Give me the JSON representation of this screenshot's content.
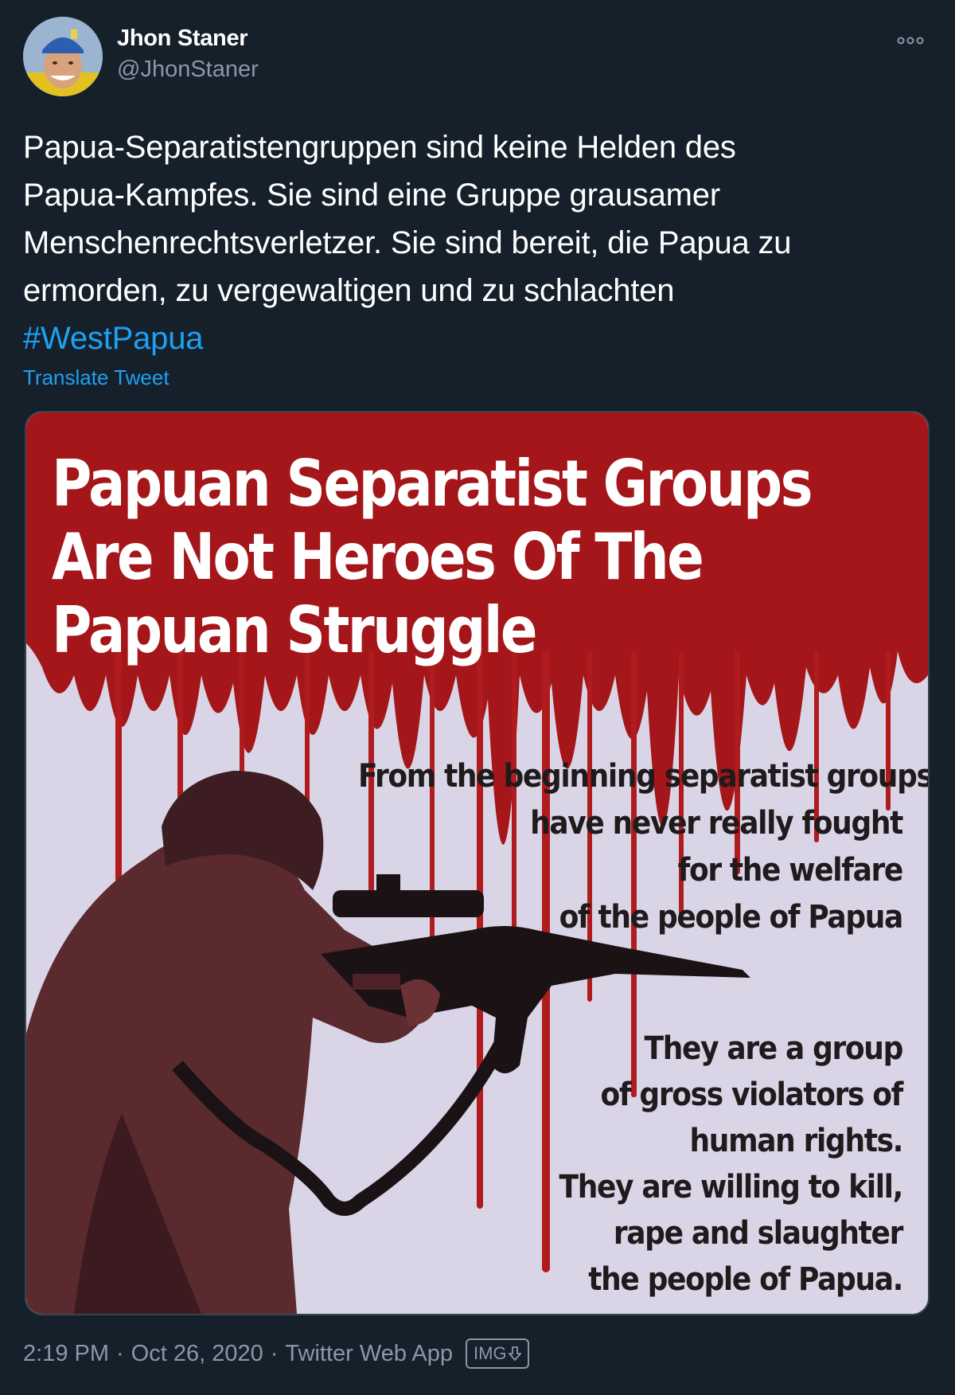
{
  "author": {
    "name": "Jhon Staner",
    "handle": "@JhonStaner"
  },
  "tweet": {
    "lines": [
      "Papua-Separatistengruppen sind keine Helden des",
      "Papua-Kampfes. Sie sind eine Gruppe grausamer",
      "Menschenrechtsverletzer. Sie sind bereit, die Papua zu",
      "ermorden, zu vergewaltigen und zu schlachten"
    ],
    "hashtag": "#WestPapua",
    "translate_label": "Translate Tweet"
  },
  "poster": {
    "title_lines": [
      "Papuan Separatist Groups",
      "Are Not Heroes Of The",
      "Papuan Struggle"
    ],
    "block1": [
      "From the beginning separatist groups",
      "have never really fought",
      "for the welfare",
      "of the people of Papua"
    ],
    "block2": [
      "They are a group",
      "of gross violators  of",
      "human rights.",
      "They are willing to kill,",
      "rape and slaughter",
      "the people of Papua."
    ]
  },
  "footer": {
    "time": "2:19 PM",
    "date": "Oct 26, 2020",
    "source": "Twitter Web App",
    "img_badge": "IMG",
    "separator": "·"
  },
  "colors": {
    "background": "#15202b",
    "secondary_text": "#8899a6",
    "link": "#1da1f2",
    "blood": "#a4161a",
    "poster_bg": "#d9d5e6"
  },
  "icons": {
    "more": "more-horizontal-icon",
    "download": "download-arrow-icon"
  }
}
